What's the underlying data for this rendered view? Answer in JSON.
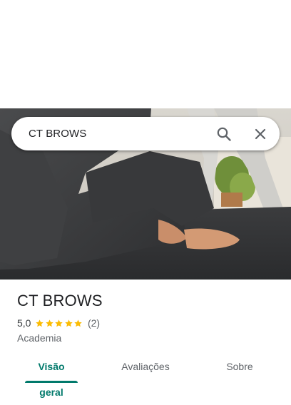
{
  "search": {
    "query": "CT BROWS",
    "search_icon": "search-icon",
    "close_icon": "close-icon"
  },
  "place": {
    "name": "CT BROWS",
    "rating": "5,0",
    "stars": 5,
    "reviews": "(2)",
    "category": "Academia"
  },
  "tabs": [
    {
      "label": "Visão geral",
      "active": true
    },
    {
      "label": "Avaliações",
      "active": false
    },
    {
      "label": "Sobre",
      "active": false
    }
  ],
  "colors": {
    "accent": "#00796b",
    "star": "#fbbc04",
    "text_primary": "#202124",
    "text_secondary": "#5f6368"
  }
}
